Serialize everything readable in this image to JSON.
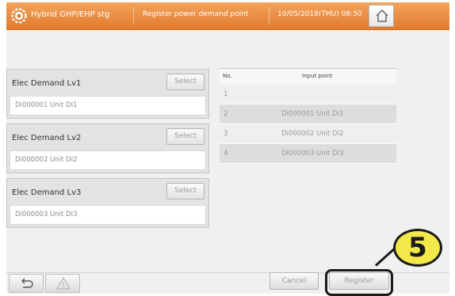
{
  "header": {
    "app_title": "Hybrid GHP/EHP stg",
    "screen_title": "Register power demand point",
    "datetime": "10/05/2018(THU) 08:50",
    "logo_icon": "gear-sun-icon",
    "home_icon": "home-icon",
    "colors": {
      "bar_top": "#f3a45c",
      "bar_bottom": "#e17a2e"
    }
  },
  "demand_levels": [
    {
      "label": "Elec Demand Lv1",
      "select_label": "Select",
      "value": "Di000001 Unit DI1"
    },
    {
      "label": "Elec Demand Lv2",
      "select_label": "Select",
      "value": "Di000002 Unit DI2"
    },
    {
      "label": "Elec Demand Lv3",
      "select_label": "Select",
      "value": "Di000003 Unit DI3"
    }
  ],
  "input_table": {
    "col_no": "No.",
    "col_input": "Input point",
    "rows": [
      {
        "no": "1",
        "value": ""
      },
      {
        "no": "2",
        "value": "Di000001 Unit DI1"
      },
      {
        "no": "3",
        "value": "Di000002 Unit DI2"
      },
      {
        "no": "4",
        "value": "Di000003 Unit DI3"
      }
    ]
  },
  "footer": {
    "back_icon": "back-arrow-icon",
    "warning_icon": "warning-icon",
    "cancel_label": "Cancel",
    "register_label": "Register"
  },
  "annotation": {
    "step_label": "5",
    "color": "#f3e84a"
  }
}
